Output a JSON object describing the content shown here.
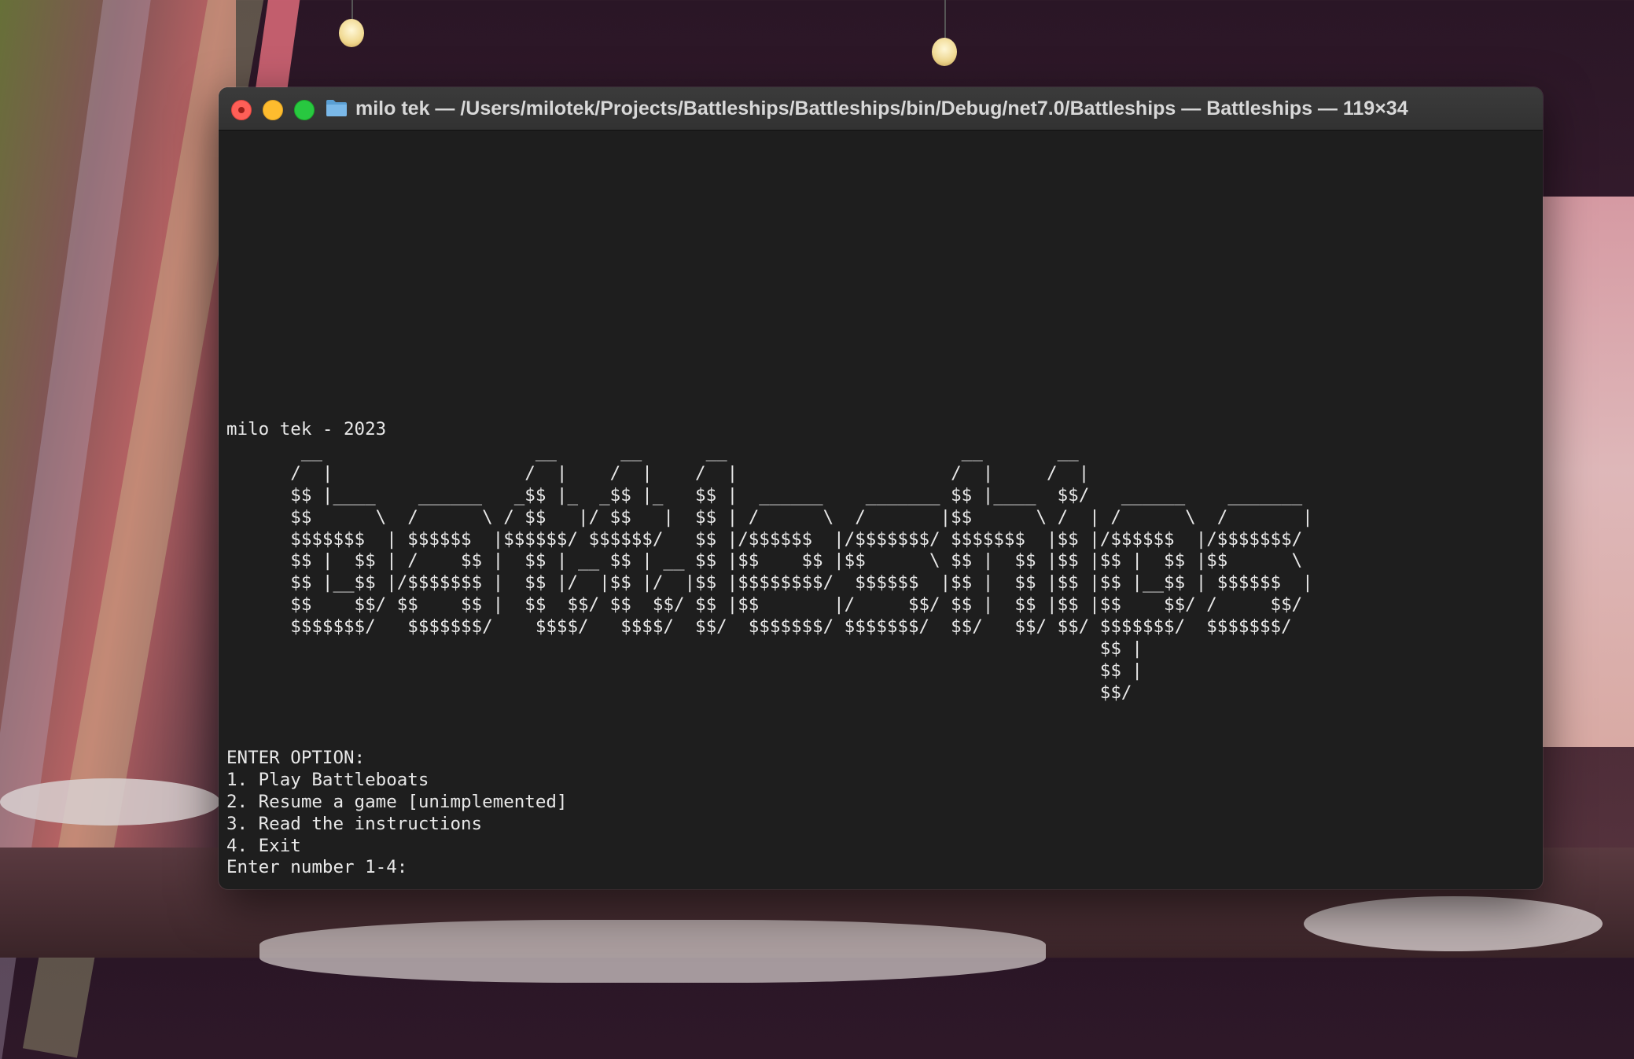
{
  "window": {
    "title": "milo tek — /Users/milotek/Projects/Battleships/Battleships/bin/Debug/net7.0/Battleships — Battleships — 119×34",
    "folder_icon": "folder-icon",
    "controls": [
      "close",
      "minimize",
      "zoom"
    ]
  },
  "terminal": {
    "credit": "milo tek - 2023",
    "ascii_art": [
      "       __                    __      __      __                      __       __",
      "      /  |                  /  |    /  |    /  |                    /  |     /  |",
      "      $$ |____    ______   _$$ |_  _$$ |_   $$ |  ______    _______ $$ |____  $$/   ______    _______",
      "      $$      \\  /      \\ / $$   |/ $$   |  $$ | /      \\  /       |$$      \\ /  | /      \\  /       |",
      "      $$$$$$$  | $$$$$$  |$$$$$$/ $$$$$$/   $$ |/$$$$$$  |/$$$$$$$/ $$$$$$$  |$$ |/$$$$$$  |/$$$$$$$/",
      "      $$ |  $$ | /    $$ |  $$ | __ $$ | __ $$ |$$    $$ |$$      \\ $$ |  $$ |$$ |$$ |  $$ |$$      \\",
      "      $$ |__$$ |/$$$$$$$ |  $$ |/  |$$ |/  |$$ |$$$$$$$$/  $$$$$$  |$$ |  $$ |$$ |$$ |__$$ | $$$$$$  |",
      "      $$    $$/ $$    $$ |  $$  $$/ $$  $$/ $$ |$$       |/     $$/ $$ |  $$ |$$ |$$    $$/ /     $$/",
      "      $$$$$$$/   $$$$$$$/    $$$$/   $$$$/  $$/  $$$$$$$/ $$$$$$$/  $$/   $$/ $$/ $$$$$$$/  $$$$$$$/",
      "                                                                                  $$ |",
      "                                                                                  $$ |",
      "                                                                                  $$/"
    ],
    "menu_header": "ENTER OPTION:",
    "options": [
      "1. Play Battleboats",
      "2. Resume a game [unimplemented]",
      "3. Read the instructions",
      "4. Exit"
    ],
    "prompt": "Enter number 1-4:"
  }
}
